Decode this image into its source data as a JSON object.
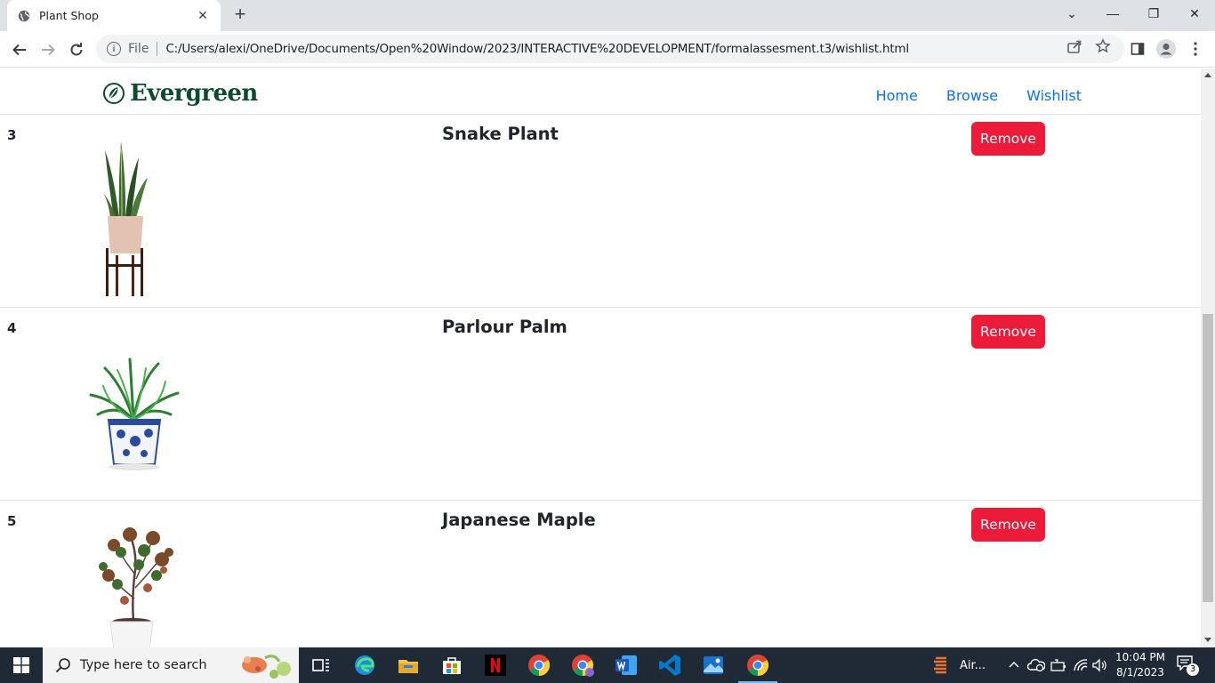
{
  "browser": {
    "tab_title": "Plant Shop",
    "tab_close": "✕",
    "new_tab": "+",
    "window_controls": [
      "⌄",
      "—",
      "❐",
      "✕"
    ],
    "scheme_label": "File",
    "url": "C:/Users/alexi/OneDrive/Documents/Open%20Window/2023/INTERACTIVE%20DEVELOPMENT/formalassesment.t3/wishlist.html"
  },
  "navbar": {
    "brand": "Evergreen",
    "links": [
      "Home",
      "Browse",
      "Wishlist"
    ]
  },
  "wishlist": {
    "rows": [
      {
        "number": "3",
        "name": "Snake Plant",
        "button": "Remove",
        "image_icon": "snake-plant"
      },
      {
        "number": "4",
        "name": "Parlour Palm",
        "button": "Remove",
        "image_icon": "parlour-palm"
      },
      {
        "number": "5",
        "name": "Japanese Maple",
        "button": "Remove",
        "image_icon": "japanese-maple"
      }
    ]
  },
  "taskbar": {
    "search_placeholder": "Type here to search",
    "weather_label": "Air...",
    "time": "10:04 PM",
    "date": "8/1/2023",
    "notification_count": "3"
  },
  "colors": {
    "accent_link": "#0d6efd",
    "remove_button": "#ed1b3a",
    "brand_green": "#0e4a32",
    "taskbar_bg": "#1f2a36"
  }
}
